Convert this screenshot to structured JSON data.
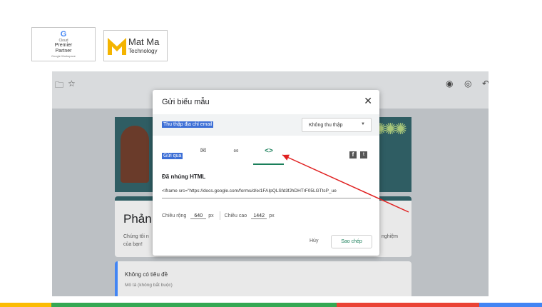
{
  "logos": {
    "partner": {
      "line1": "Premier",
      "line2": "Partner",
      "line3": "Google Workspace",
      "small": "Cloud"
    },
    "company": {
      "name": "Mat Ma",
      "sub": "Technology"
    }
  },
  "form_bg": {
    "title_partial": "Phản",
    "desc_line1": "Chúng tôi n",
    "desc_line2": "của bạn!",
    "desc_right": "nghiệm",
    "question_title": "Không có tiêu đề",
    "question_desc": "Mô tả (không bắt buộc)"
  },
  "dialog": {
    "title": "Gửi biểu mẫu",
    "collect_label": "Thu thập địa chỉ email",
    "collect_value": "Không thu thập",
    "send_label": "Gửi qua",
    "embed_heading": "Đã nhúng HTML",
    "embed_code": "<iframe src=\"https://docs.google.com/forms/d/e/1FAIpQLSfd3fJhDHTrF05LGTtcP_ue",
    "width_label": "Chiều rộng",
    "width_value": "640",
    "height_label": "Chiều cao",
    "height_value": "1442",
    "unit": "px",
    "cancel_label": "Hủy",
    "copy_label": "Sao chép"
  },
  "colors": {
    "accent": "#1a7f5a",
    "highlight": "#3d6fd6",
    "arrow": "#e02020",
    "stripe": [
      "#fbbc04",
      "#34a853",
      "#ea4335",
      "#4285f4"
    ]
  },
  "icons": [
    "folder-icon",
    "star-icon",
    "palette-icon",
    "eye-icon",
    "close-icon",
    "mail-icon",
    "link-icon",
    "embed-icon",
    "facebook-icon",
    "twitter-icon",
    "chevron-down-icon"
  ]
}
